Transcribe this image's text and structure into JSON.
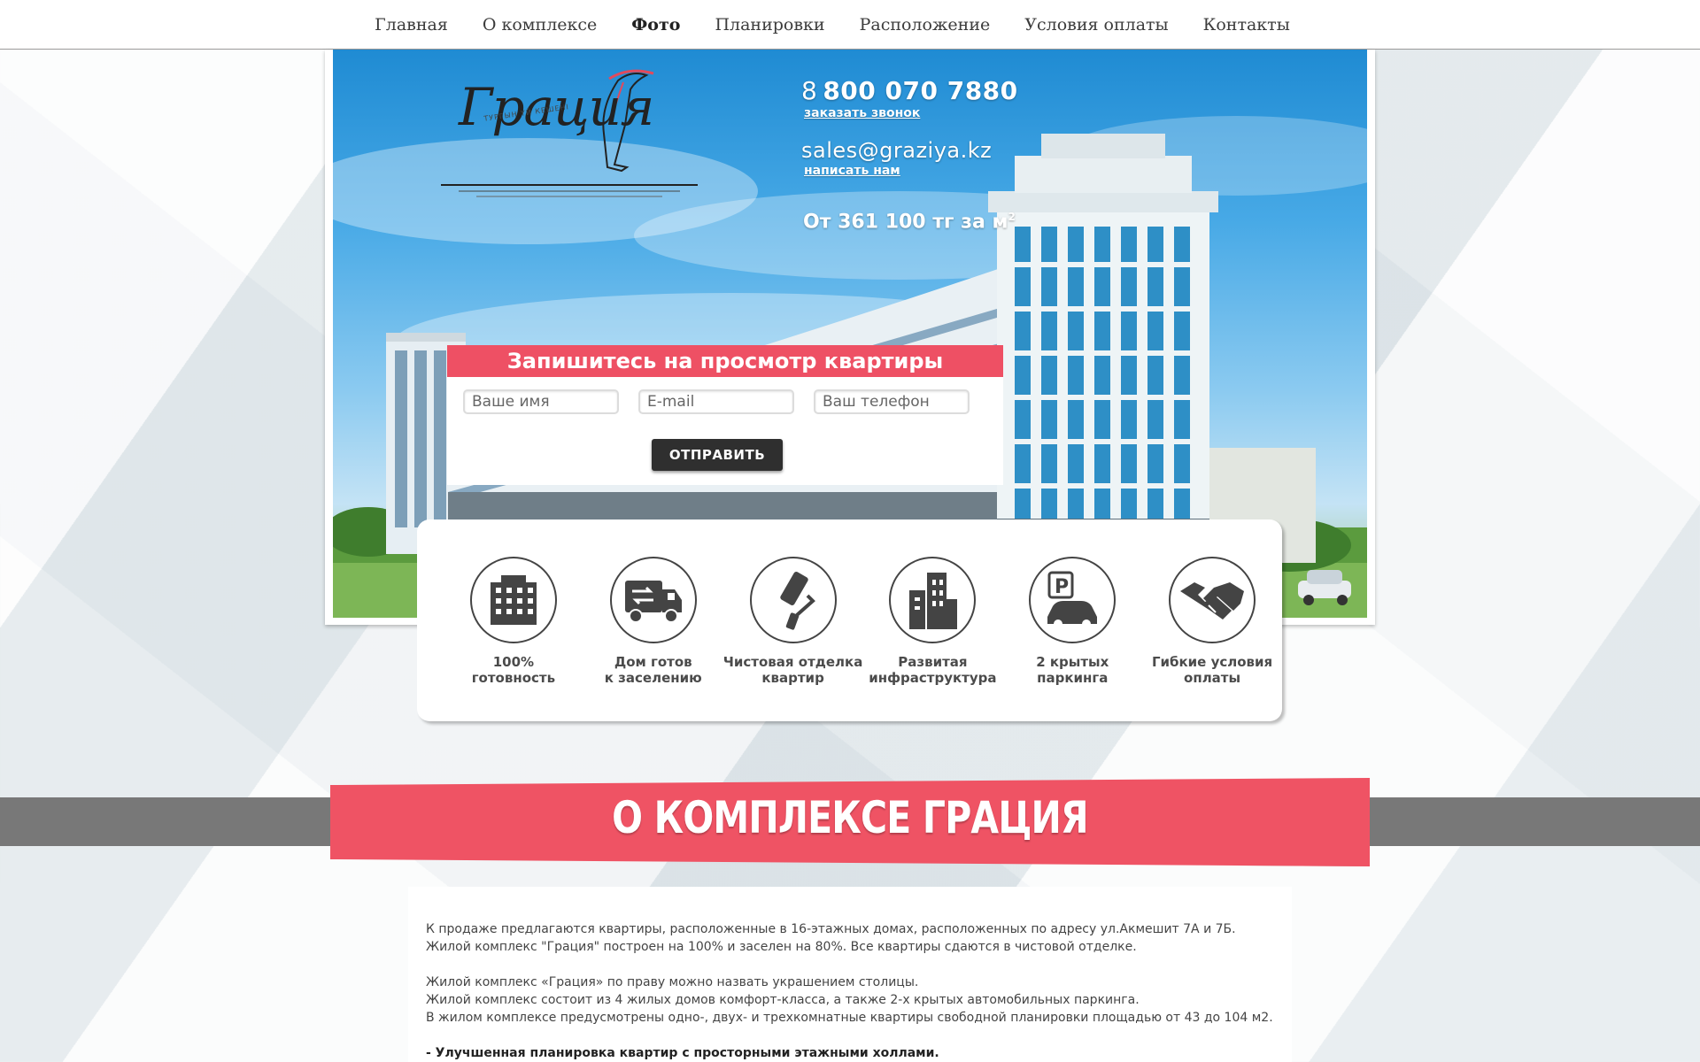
{
  "nav": {
    "items": [
      {
        "label": "Главная",
        "active": false
      },
      {
        "label": "О комплексе",
        "active": false
      },
      {
        "label": "Фото",
        "active": true
      },
      {
        "label": "Планировки",
        "active": false
      },
      {
        "label": "Расположение",
        "active": false
      },
      {
        "label": "Условия оплаты",
        "active": false
      },
      {
        "label": "Контакты",
        "active": false
      }
    ]
  },
  "hero": {
    "logo_text": "Грация",
    "logo_tagline": "ТУРГЫН ҮЙ КЕШЕНІ",
    "phone_prefix": "8",
    "phone_number": "800 070 7880",
    "callback_link": "заказать звонок",
    "email": "sales@graziya.kz",
    "write_link": "написать нам",
    "price": "От 361 100 тг за м",
    "price_unit_sup": "2"
  },
  "signup_form": {
    "title": "Запишитесь на просмотр квартиры",
    "name_placeholder": "Ваше имя",
    "email_placeholder": "E-mail",
    "phone_placeholder": "Ваш телефон",
    "submit_label": "ОТПРАВИТЬ"
  },
  "features": [
    {
      "icon": "building-icon",
      "line1": "100%",
      "line2": "готовность"
    },
    {
      "icon": "moving-truck-icon",
      "line1": "Дом готов",
      "line2": "к заселению"
    },
    {
      "icon": "paint-roller-icon",
      "line1": "Чистовая отделка",
      "line2": "квартир"
    },
    {
      "icon": "city-buildings-icon",
      "line1": "Развитая",
      "line2": "инфраструктура"
    },
    {
      "icon": "parking-car-icon",
      "line1": "2 крытых",
      "line2": "паркинга"
    },
    {
      "icon": "handshake-icon",
      "line1": "Гибкие условия",
      "line2": "оплаты"
    }
  ],
  "about": {
    "title": "О КОМПЛЕКСЕ ГРАЦИЯ",
    "p1": "К продаже предлагаются квартиры, расположенные в 16-этажных домах, расположенных по адресу ул.Акмешит 7А и 7Б.",
    "p2": "Жилой комплекс \"Грация\" построен на 100%  и заселен на 80%. Все квартиры сдаются в чистовой отделке.",
    "p3": "Жилой комплекс «Грация» по праву можно назвать украшением столицы.",
    "p4": "Жилой комплекс состоит из 4 жилых домов комфорт-класса, а также 2-х крытых автомобильных паркинга.",
    "p5": "В жилом комплексе предусмотрены одно-, двух- и трехкомнатные квартиры свободной планировки площадью от 43 до 104 м2.",
    "p6": "- Улучшенная планировка квартир с просторными этажными холлами."
  },
  "colors": {
    "accent": "#ee5064",
    "stripe": "#787878",
    "button": "#2f2f2f"
  }
}
